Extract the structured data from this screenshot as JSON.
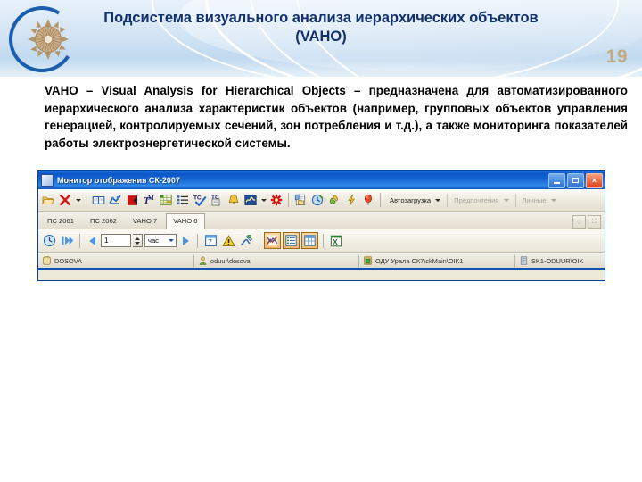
{
  "slide": {
    "title": "Подсистема визуального анализа иерархических объектов (VAHO)",
    "page_number": "19",
    "body": "VAHO – Visual Analysis for Hierarchical Objects – предназначена для автоматизированного иерархического анализа характеристик объектов (например, групповых объектов управления генерацией, контролируемых сечений, зон потребления и т.д.), а также мониторинга показателей работы электроэнергетической системы.",
    "logo_name": "organization-logo",
    "colors": {
      "title_blue": "#10306e",
      "header_blue": "#bed8ef",
      "page_number_gold": "#c3a97e",
      "logo_arc_blue": "#1a5fad",
      "logo_wheel_tan": "#c9a67d"
    }
  },
  "app": {
    "title": "Монитор отображения СК-2007",
    "window_controls": {
      "minimize": "minimize-button",
      "maximize": "maximize-button",
      "close": "×"
    },
    "toolbar": {
      "icons": [
        {
          "name": "open-folder-icon",
          "glyph": "folder"
        },
        {
          "name": "delete-red-x-icon",
          "glyph": "redx"
        },
        {
          "name": "delete-dropdown-caret",
          "glyph": "caret"
        },
        {
          "name": "book-icon",
          "glyph": "book"
        },
        {
          "name": "blue-chart-icon",
          "glyph": "bluechart"
        },
        {
          "name": "red-block-icon",
          "glyph": "redblock"
        },
        {
          "name": "tm-icon",
          "glyph": "tm"
        },
        {
          "name": "green-grid-icon",
          "glyph": "greengrid"
        },
        {
          "name": "list-icon",
          "glyph": "list"
        },
        {
          "name": "tc-check-icon",
          "glyph": "tccheck"
        },
        {
          "name": "tc-copy-icon",
          "glyph": "tccopy"
        },
        {
          "name": "bell-icon",
          "glyph": "bell"
        },
        {
          "name": "signal-curve-icon",
          "glyph": "signal"
        },
        {
          "name": "signal-dropdown-caret",
          "glyph": "caret"
        },
        {
          "name": "red-asterisk-icon",
          "glyph": "asterisk"
        },
        {
          "name": "report-icon",
          "glyph": "report"
        },
        {
          "name": "clock-icon",
          "glyph": "clock"
        },
        {
          "name": "plug-icon",
          "glyph": "plug"
        },
        {
          "name": "lightning-icon",
          "glyph": "lightning"
        },
        {
          "name": "balloon-icon",
          "glyph": "balloon"
        }
      ],
      "dropdowns": [
        {
          "label": "Автозагрузка",
          "disabled": false
        },
        {
          "label": "Предпочтения",
          "disabled": true
        },
        {
          "label": "Личные",
          "disabled": true
        }
      ]
    },
    "tabs": [
      {
        "label": "ПС 2061",
        "active": false
      },
      {
        "label": "ПС 2062",
        "active": false
      },
      {
        "label": "VAHO 7",
        "active": false
      },
      {
        "label": "VAHO 6",
        "active": true
      }
    ],
    "tab_buttons": [
      {
        "name": "tab-restore-button",
        "glyph": "♡"
      },
      {
        "name": "tab-close-button",
        "glyph": "⛶"
      }
    ],
    "navbar": {
      "refresh_icon": "refresh-clock-icon",
      "playall_icon": "play-all-icon",
      "prev_icon": "previous-arrow-icon",
      "interval_value": "1",
      "unit_value": "час",
      "next_icon": "next-arrow-icon",
      "calendar_icon": "calendar-icon",
      "calendar_day": "7",
      "warning_icon": "warning-triangle-icon",
      "sign-tool_icon": "signature-tool-icon",
      "view_toggles": [
        {
          "name": "chart-view-toggle",
          "active": true
        },
        {
          "name": "list-view-toggle",
          "active": true
        },
        {
          "name": "table-view-toggle",
          "active": true
        }
      ],
      "export_icon": "excel-export-icon"
    },
    "statusbar": [
      {
        "icon": "database-icon",
        "text": "DOSOVA"
      },
      {
        "icon": "user-icon",
        "text": "oduur\\dosova"
      },
      {
        "icon": "server-icon",
        "text": "ОДУ Урала СК7\\ckMain\\OIK1"
      },
      {
        "icon": "node-icon",
        "text": "SK1-ODUUR\\OIK"
      }
    ]
  }
}
